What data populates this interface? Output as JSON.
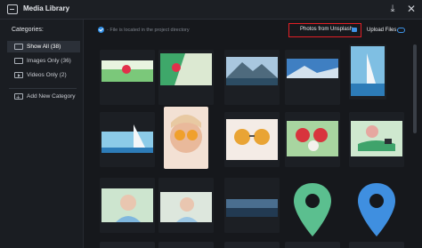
{
  "window": {
    "title": "Media Library",
    "icon": "media-library-icon",
    "download_icon": "download-icon",
    "close_icon": "close-icon",
    "close_glyph": "✕",
    "download_glyph": "⤓"
  },
  "sidebar": {
    "heading": "Categories:",
    "items": [
      {
        "label": "Show All (38)",
        "icon": "image-icon",
        "active": true
      },
      {
        "label": "Images Only (36)",
        "icon": "image-icon",
        "active": false
      },
      {
        "label": "Videos Only (2)",
        "icon": "video-icon",
        "active": false
      }
    ],
    "add_category": {
      "label": "Add New Category",
      "icon": "add-icon"
    }
  },
  "toolbar": {
    "info_text": "- File is located in the project directory",
    "unsplash_label": "Photos from Unsplash",
    "upload_label": "Upload Files"
  },
  "colors": {
    "highlight_border": "#e21f26",
    "accent": "#3e94e8",
    "marker_green": "#5bbf8f",
    "marker_blue": "#3f8fe0"
  },
  "grid": {
    "thumbnails": [
      {
        "name": "raspberry-on-green-thumbnail",
        "subject": "raspberry"
      },
      {
        "name": "raspberry-on-lime-thumbnail",
        "subject": "raspberry"
      },
      {
        "name": "mountain-lake-thumbnail",
        "subject": "mountain"
      },
      {
        "name": "mountain-sky-thumbnail",
        "subject": "mountain"
      },
      {
        "name": "sailboat-thumbnail",
        "subject": "sailboat"
      },
      {
        "name": "sailboat-sea-thumbnail",
        "subject": "sailboat"
      },
      {
        "name": "woman-sunglasses-thumbnail",
        "subject": "portrait"
      },
      {
        "name": "sunglasses-thumbnail",
        "subject": "sunglasses"
      },
      {
        "name": "sunglasses-red-thumbnail",
        "subject": "sunglasses"
      },
      {
        "name": "plant-pot-thumbnail",
        "subject": "plant"
      },
      {
        "name": "woman-portrait-thumbnail",
        "subject": "portrait"
      },
      {
        "name": "woman-portrait-wide-thumbnail",
        "subject": "portrait"
      },
      {
        "name": "landscape-dusk-thumbnail",
        "subject": "landscape"
      },
      {
        "name": "green-map-marker-thumbnail",
        "subject": "marker"
      },
      {
        "name": "blue-map-marker-thumbnail",
        "subject": "marker"
      }
    ]
  }
}
